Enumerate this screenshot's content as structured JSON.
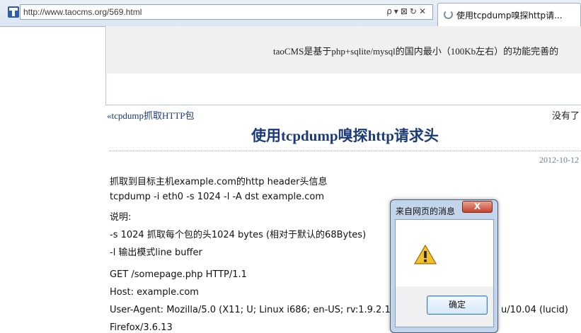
{
  "browser": {
    "url": "http://www.taocms.org/569.html",
    "tab_title": "使用tcpdump嗅探http请...",
    "address_icons": "ρ▾⊠↻✕"
  },
  "banner": {
    "text": "taoCMS是基于php+sqlite/mysql的国内最小（100Kb左右）的功能完善的"
  },
  "nav": {
    "prev": "«tcpdump抓取HTTP包",
    "next": "没有了"
  },
  "post": {
    "title": "使用tcpdump嗅探http请求头",
    "date": "2012-10-12",
    "lines": [
      "抓取到目标主机example.com的http header头信息",
      "tcpdump -i eth0 -s 1024 -l -A dst example.com",
      "说明:",
      "-s 1024 抓取每个包的头1024 bytes (相对于默认的68Bytes)",
      "-l 输出模式line buffer",
      "GET /somepage.php HTTP/1.1",
      "Host: example.com",
      "User-Agent: Mozilla/5.0 (X11; U; Linux i686; en-US; rv:1.9.2.13)",
      "u/10.04 (lucid)",
      "Firefox/3.6.13"
    ]
  },
  "dialog": {
    "title": "来自网页的消息",
    "close": "X",
    "ok_label": "确定",
    "icon": "warning-icon"
  },
  "colors": {
    "link": "#1b3a78",
    "dialog_frame": "#c3d5ea",
    "close_button": "#c7432c"
  }
}
